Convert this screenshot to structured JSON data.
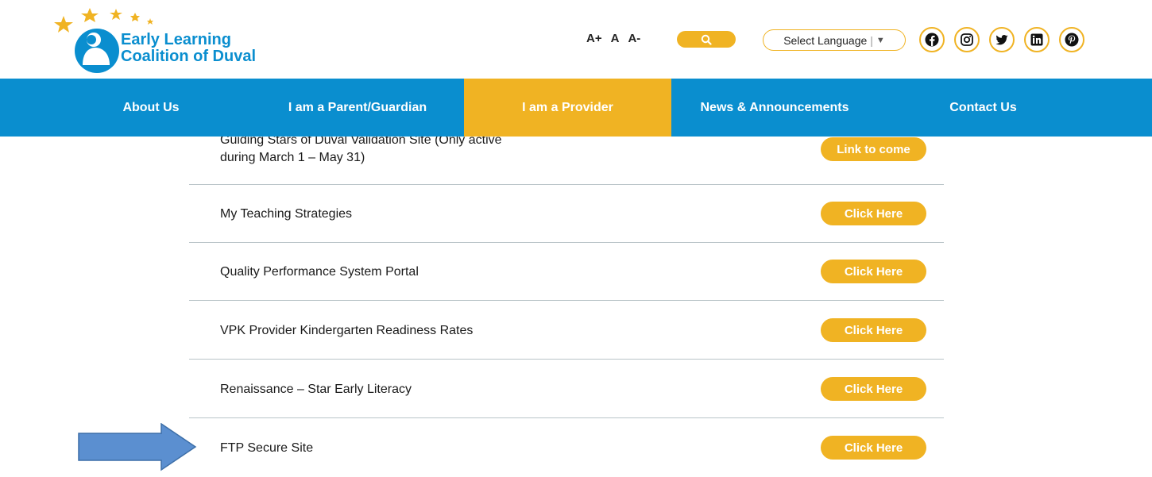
{
  "header": {
    "logo_line1": "Early Learning",
    "logo_line2": "Coalition of Duval",
    "font_controls": [
      "A+",
      "A",
      "A-"
    ],
    "search_icon": "search-icon",
    "language_label": "Select Language",
    "language_sep": "|",
    "language_arrow": "▼",
    "social_icons": [
      "facebook-icon",
      "instagram-icon",
      "twitter-icon",
      "linkedin-icon",
      "pinterest-icon"
    ]
  },
  "nav": {
    "items": [
      {
        "label": "About Us"
      },
      {
        "label": "I am a Parent/Guardian"
      },
      {
        "label": "I am a Provider",
        "active": true
      },
      {
        "label": "News & Announcements"
      },
      {
        "label": "Contact Us"
      }
    ]
  },
  "resources": [
    {
      "label_line1": "Guiding Stars of Duval Validation Site (Only active",
      "label_line2": "during March 1 – May 31)",
      "button": "Link to come"
    },
    {
      "label": "My Teaching Strategies",
      "button": "Click Here"
    },
    {
      "label": "Quality Performance System Portal",
      "button": "Click Here"
    },
    {
      "label": "VPK Provider Kindergarten Readiness Rates",
      "button": "Click Here"
    },
    {
      "label": "Renaissance – Star Early Literacy",
      "button": "Click Here"
    },
    {
      "label": "FTP Secure Site",
      "button": "Click Here"
    }
  ],
  "colors": {
    "brand_blue": "#0a8ecf",
    "accent_yellow": "#f0b323",
    "annotation_arrow": "#5b8fd0"
  }
}
